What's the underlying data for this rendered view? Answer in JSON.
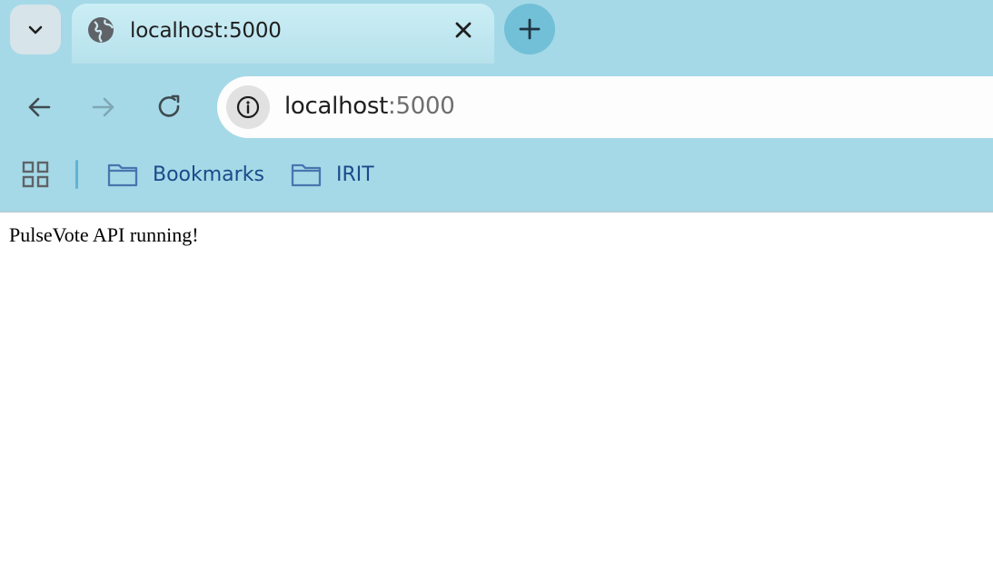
{
  "tab": {
    "title": "localhost:5000",
    "favicon": "globe-icon"
  },
  "toolbar": {
    "url_host": "localhost",
    "url_port": ":5000"
  },
  "bookmarks": {
    "items": [
      {
        "label": "Bookmarks",
        "icon": "folder-icon"
      },
      {
        "label": "IRIT",
        "icon": "folder-icon"
      }
    ]
  },
  "page": {
    "body_text": "PulseVote API running!"
  },
  "colors": {
    "chrome": "#a5d9e7",
    "tab_active": "#bfe6ef",
    "new_tab_button": "#72bfd8",
    "bookmark_text": "#1a4a8a"
  }
}
